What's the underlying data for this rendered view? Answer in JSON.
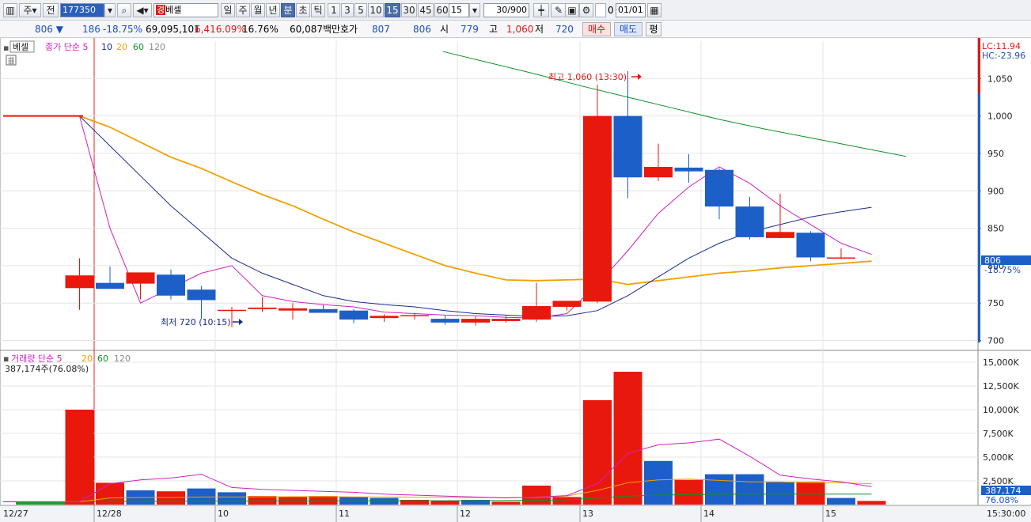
{
  "toolbar": {
    "market": "주",
    "prev": "전",
    "code": "177350",
    "stock_name": "베셀",
    "stock_tag": "경",
    "periods": [
      "일",
      "주",
      "월",
      "년",
      "분",
      "초",
      "틱"
    ],
    "selected_period": "분",
    "minutes": [
      "1",
      "3",
      "5",
      "10",
      "15",
      "30",
      "45",
      "60"
    ],
    "selected_minute": "15",
    "interval_value": "15",
    "count_display": "30",
    "count_total": "/900",
    "check_label": "0",
    "date_value": "01/01"
  },
  "info": {
    "price": "806",
    "change_arrow": "▼",
    "change": "186",
    "change_pct": "-18.75%",
    "volume": "69,095,101",
    "volume_pct": "6,416.09%",
    "turnover_pct": "16.76%",
    "amount": "60,087백만",
    "ask_label": "호가",
    "ask1": "807",
    "ask2": "806",
    "open_label": "시",
    "open": "779",
    "high_label": "고",
    "high": "1,060",
    "low_label": "저",
    "low": "720",
    "buy_label": "매수",
    "sell_label": "매도",
    "eval_label": "평"
  },
  "price_panel": {
    "stock_label": "베셀",
    "legend_prefix": "종가 단순 5",
    "legend_10": "10",
    "legend_20": "20",
    "legend_60": "60",
    "legend_120": "120",
    "lc": "LC:11.94",
    "hc": "HC:-23.96",
    "price_tag": "806",
    "price_tag_pct": "-18.75%",
    "max_note": "최고 1,060 (13:30)",
    "min_note": "최저 720 (10:15)"
  },
  "volume_panel": {
    "legend_prefix": "거래량 단순 5",
    "legend_20": "20",
    "legend_60": "60",
    "legend_120": "120",
    "current": "387,174주(76.08%)",
    "vol_tag": "387,174",
    "vol_tag_pct": "76.08%"
  },
  "time_axis": {
    "date_left": "12/27",
    "labels": [
      "12/28",
      "10",
      "11",
      "12",
      "13",
      "14",
      "15"
    ],
    "time_right": "15:30:00"
  },
  "colors": {
    "up": "#e8190c",
    "down": "#1d5fc8",
    "ma5": "#d020c0",
    "ma10": "#1a2a8c",
    "ma20": "#f0a000",
    "ma60": "#10902a"
  },
  "chart_data": {
    "type": "candlestick",
    "price_axis": {
      "ticks": [
        700,
        750,
        800,
        850,
        900,
        950,
        1000,
        1050
      ],
      "range": [
        690,
        1100
      ]
    },
    "volume_axis": {
      "ticks": [
        "2,500K",
        "5,000K",
        "7,500K",
        "10,000K",
        "12,500K",
        "15,000K"
      ],
      "range": [
        0,
        16000
      ]
    },
    "candles": [
      {
        "o": 1000,
        "h": 1000,
        "l": 1000,
        "c": 1000
      },
      {
        "o": 770,
        "h": 810,
        "l": 741,
        "c": 787
      },
      {
        "o": 777,
        "h": 799,
        "l": 770,
        "c": 769
      },
      {
        "o": 776,
        "h": 790,
        "l": 755,
        "c": 791
      },
      {
        "o": 788,
        "h": 795,
        "l": 755,
        "c": 760
      },
      {
        "o": 768,
        "h": 773,
        "l": 729,
        "c": 754
      },
      {
        "o": 741,
        "h": 745,
        "l": 718,
        "c": 741
      },
      {
        "o": 742,
        "h": 758,
        "l": 738,
        "c": 744
      },
      {
        "o": 740,
        "h": 750,
        "l": 728,
        "c": 743
      },
      {
        "o": 742,
        "h": 748,
        "l": 737,
        "c": 737
      },
      {
        "o": 740,
        "h": 742,
        "l": 723,
        "c": 728
      },
      {
        "o": 730,
        "h": 735,
        "l": 725,
        "c": 733
      },
      {
        "o": 733,
        "h": 737,
        "l": 728,
        "c": 734
      },
      {
        "o": 729,
        "h": 733,
        "l": 721,
        "c": 724
      },
      {
        "o": 724,
        "h": 732,
        "l": 720,
        "c": 729
      },
      {
        "o": 726,
        "h": 733,
        "l": 724,
        "c": 729
      },
      {
        "o": 728,
        "h": 777,
        "l": 725,
        "c": 746
      },
      {
        "o": 745,
        "h": 752,
        "l": 740,
        "c": 753
      },
      {
        "o": 752,
        "h": 1042,
        "l": 750,
        "c": 1000
      },
      {
        "o": 1000,
        "h": 1060,
        "l": 890,
        "c": 918
      },
      {
        "o": 918,
        "h": 963,
        "l": 913,
        "c": 932
      },
      {
        "o": 931,
        "h": 949,
        "l": 911,
        "c": 926
      },
      {
        "o": 928,
        "h": 930,
        "l": 862,
        "c": 879
      },
      {
        "o": 879,
        "h": 892,
        "l": 835,
        "c": 838
      },
      {
        "o": 837,
        "h": 896,
        "l": 837,
        "c": 845
      },
      {
        "o": 844,
        "h": 846,
        "l": 806,
        "c": 811
      },
      {
        "o": 811,
        "h": 823,
        "l": 809,
        "c": 811
      }
    ],
    "volumes_k": [
      300,
      10000,
      2300,
      1500,
      1400,
      1700,
      1300,
      900,
      800,
      900,
      800,
      700,
      500,
      400,
      500,
      300,
      2000,
      800,
      11000,
      14000,
      4600,
      2600,
      3200,
      3200,
      2400,
      2400,
      700,
      387
    ],
    "ma5": [
      1000,
      1000,
      850,
      750,
      770,
      790,
      800,
      760,
      752,
      748,
      745,
      738,
      736,
      734,
      733,
      731,
      730,
      736,
      775,
      820,
      870,
      905,
      932,
      910,
      880,
      855,
      830,
      815
    ],
    "ma10": [
      1000,
      1000,
      960,
      920,
      880,
      845,
      810,
      790,
      775,
      760,
      752,
      748,
      745,
      740,
      736,
      734,
      732,
      733,
      740,
      760,
      785,
      810,
      830,
      845,
      855,
      865,
      872,
      878
    ],
    "ma20": [
      1000,
      1000,
      985,
      965,
      945,
      930,
      912,
      895,
      880,
      862,
      845,
      830,
      815,
      800,
      790,
      781,
      780,
      781,
      782,
      775,
      780,
      785,
      790,
      793,
      797,
      800,
      803,
      806
    ],
    "ma60": [
      1086,
      1071,
      1056,
      1040,
      1025,
      1010,
      995,
      982,
      970,
      958,
      946
    ],
    "vol_ma5": [
      300,
      300,
      2200,
      2600,
      2800,
      3200,
      1800,
      1600,
      1500,
      1400,
      1300,
      1100,
      1000,
      900,
      800,
      700,
      800,
      950,
      2200,
      5400,
      6300,
      6500,
      6900,
      5100,
      3100,
      2700,
      2400,
      1900
    ],
    "vol_ma20": [
      300,
      300,
      700,
      750,
      750,
      800,
      800,
      820,
      830,
      840,
      820,
      800,
      780,
      760,
      740,
      730,
      760,
      900,
      1500,
      2300,
      2600,
      2700,
      2550,
      2400,
      2400,
      2300,
      2300,
      2200
    ],
    "vol_ma60": [
      300,
      300,
      350,
      360,
      360,
      370,
      380,
      380,
      390,
      390,
      400,
      400,
      410,
      410,
      420,
      430,
      450,
      500,
      700,
      900,
      1000,
      1050,
      1080,
      1100,
      1100,
      1100,
      1100,
      1100
    ]
  }
}
